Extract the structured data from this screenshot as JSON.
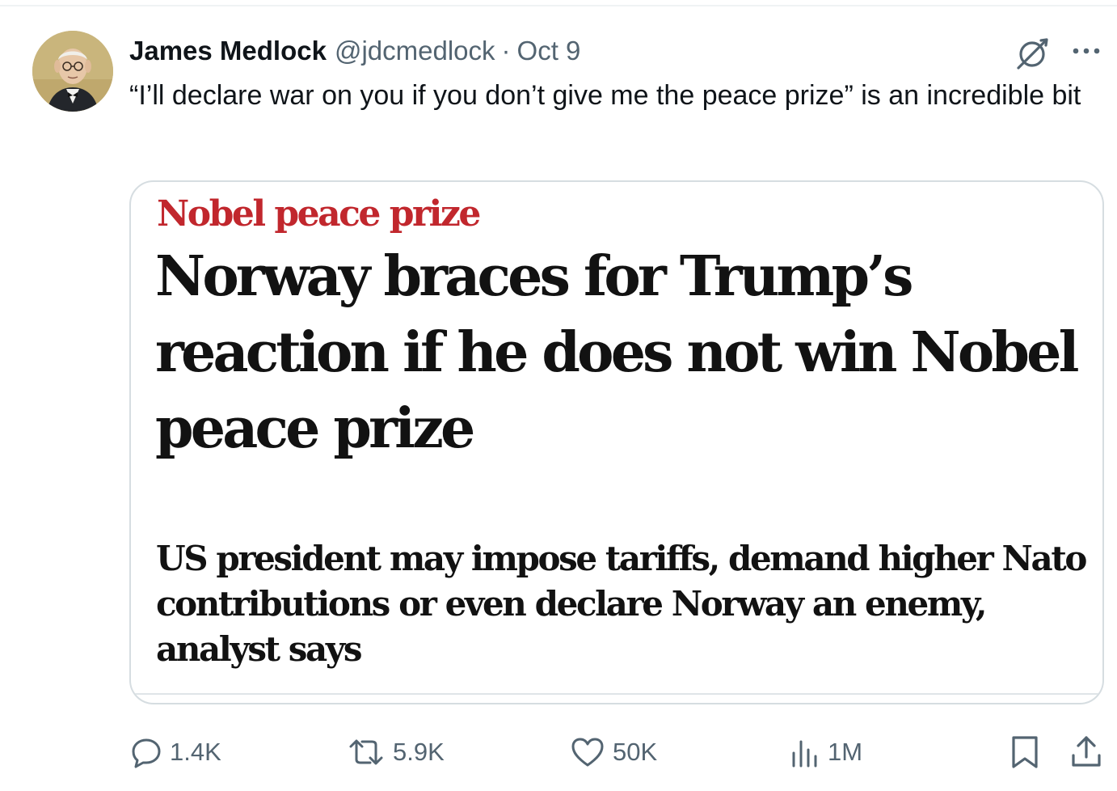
{
  "tweet": {
    "author_name": "James Medlock",
    "handle": "@jdcmedlock",
    "separator": "·",
    "date": "Oct 9",
    "text": "“I’ll declare war on you if you don’t give me the peace prize” is an incredible bit"
  },
  "card": {
    "kicker": "Nobel peace prize",
    "headline": "Norway braces for Trump’s reaction if he does not win Nobel peace prize",
    "standfirst": "US president may impose tariffs, demand higher Nato contributions or even declare Norway an enemy, analyst says",
    "kicker_color": "#c1272d"
  },
  "actions": {
    "replies": "1.4K",
    "reposts": "5.9K",
    "likes": "50K",
    "views": "1M"
  },
  "icons": {
    "grok": "grok-icon",
    "more": "more-icon",
    "reply": "reply-icon",
    "repost": "repost-icon",
    "like": "heart-icon",
    "views": "views-icon",
    "bookmark": "bookmark-icon",
    "share": "share-icon"
  },
  "colors": {
    "text": "#0f1419",
    "secondary": "#536471",
    "border": "#d6dde1"
  }
}
